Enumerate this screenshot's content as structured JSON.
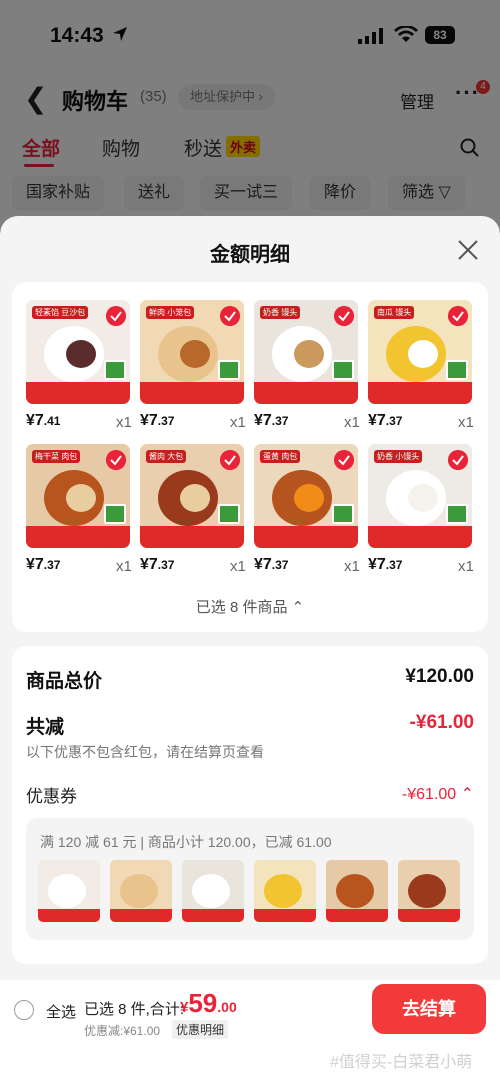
{
  "status_bar": {
    "time": "14:43",
    "battery": "83"
  },
  "header": {
    "title": "购物车",
    "count": "(35)",
    "address": "地址保护中",
    "manage": "管理",
    "more_badge": "4"
  },
  "tabs": [
    {
      "label": "全部"
    },
    {
      "label": "购物"
    },
    {
      "label": "秒送",
      "tag": "外卖"
    }
  ],
  "filters": [
    "国家补贴",
    "送礼",
    "买一试三",
    "降价",
    "筛选"
  ],
  "sheet": {
    "title": "金额明细",
    "products": [
      {
        "price_int": "¥7",
        "price_dec": ".41",
        "qty": "x1",
        "img_color": "#f3ece6",
        "food_color": "#ffffff",
        "food2_color": "#5a2c2c",
        "tag": "轻素馅 豆沙包"
      },
      {
        "price_int": "¥7",
        "price_dec": ".37",
        "qty": "x1",
        "img_color": "#f1d9b5",
        "food_color": "#e8c48c",
        "food2_color": "#b7682a",
        "tag": "鲜肉 小笼包"
      },
      {
        "price_int": "¥7",
        "price_dec": ".37",
        "qty": "x1",
        "img_color": "#e9e4dc",
        "food_color": "#ffffff",
        "food2_color": "#c99a5b",
        "tag": "奶香 馒头"
      },
      {
        "price_int": "¥7",
        "price_dec": ".37",
        "qty": "x1",
        "img_color": "#f3e4bd",
        "food_color": "#f2c42f",
        "food2_color": "#ffffff",
        "tag": "南瓜 馒头"
      },
      {
        "price_int": "¥7",
        "price_dec": ".37",
        "qty": "x1",
        "img_color": "#e6c9a6",
        "food_color": "#b8541e",
        "food2_color": "#e8cd9e",
        "tag": "梅干菜 肉包"
      },
      {
        "price_int": "¥7",
        "price_dec": ".37",
        "qty": "x1",
        "img_color": "#eacfae",
        "food_color": "#9a3a1c",
        "food2_color": "#e8cd9e",
        "tag": "酱肉 大包"
      },
      {
        "price_int": "¥7",
        "price_dec": ".37",
        "qty": "x1",
        "img_color": "#ebd8bd",
        "food_color": "#b5541f",
        "food2_color": "#f28c18",
        "tag": "蛋黄 肉包"
      },
      {
        "price_int": "¥7",
        "price_dec": ".37",
        "qty": "x1",
        "img_color": "#eeebe6",
        "food_color": "#ffffff",
        "food2_color": "#f6f3ee",
        "tag": "奶香 小馒头"
      }
    ],
    "selected_text": "已选 8 件商品",
    "summary": {
      "total_label": "商品总价",
      "total_value": "¥120.00",
      "reduce_label": "共减",
      "reduce_value": "-¥61.00",
      "hint": "以下优惠不包含红包，请在结算页查看",
      "coupon_label": "优惠券",
      "coupon_value": "-¥61.00",
      "coupon_desc": "满 120 减 61 元 | 商品小计 120.00，已减 61.00"
    }
  },
  "checkout": {
    "select_all": "全选",
    "selected_summary": "已选 8 件,合计:",
    "currency": "¥",
    "total_int": "59",
    "total_dec": ".00",
    "discount": "优惠减:¥61.00",
    "detail_button": "优惠明细",
    "pay_button": "去结算",
    "watermark": "#值得买-白菜君小萌"
  },
  "colors": {
    "accent": "#e8233a",
    "pay": "#f23a3a"
  }
}
